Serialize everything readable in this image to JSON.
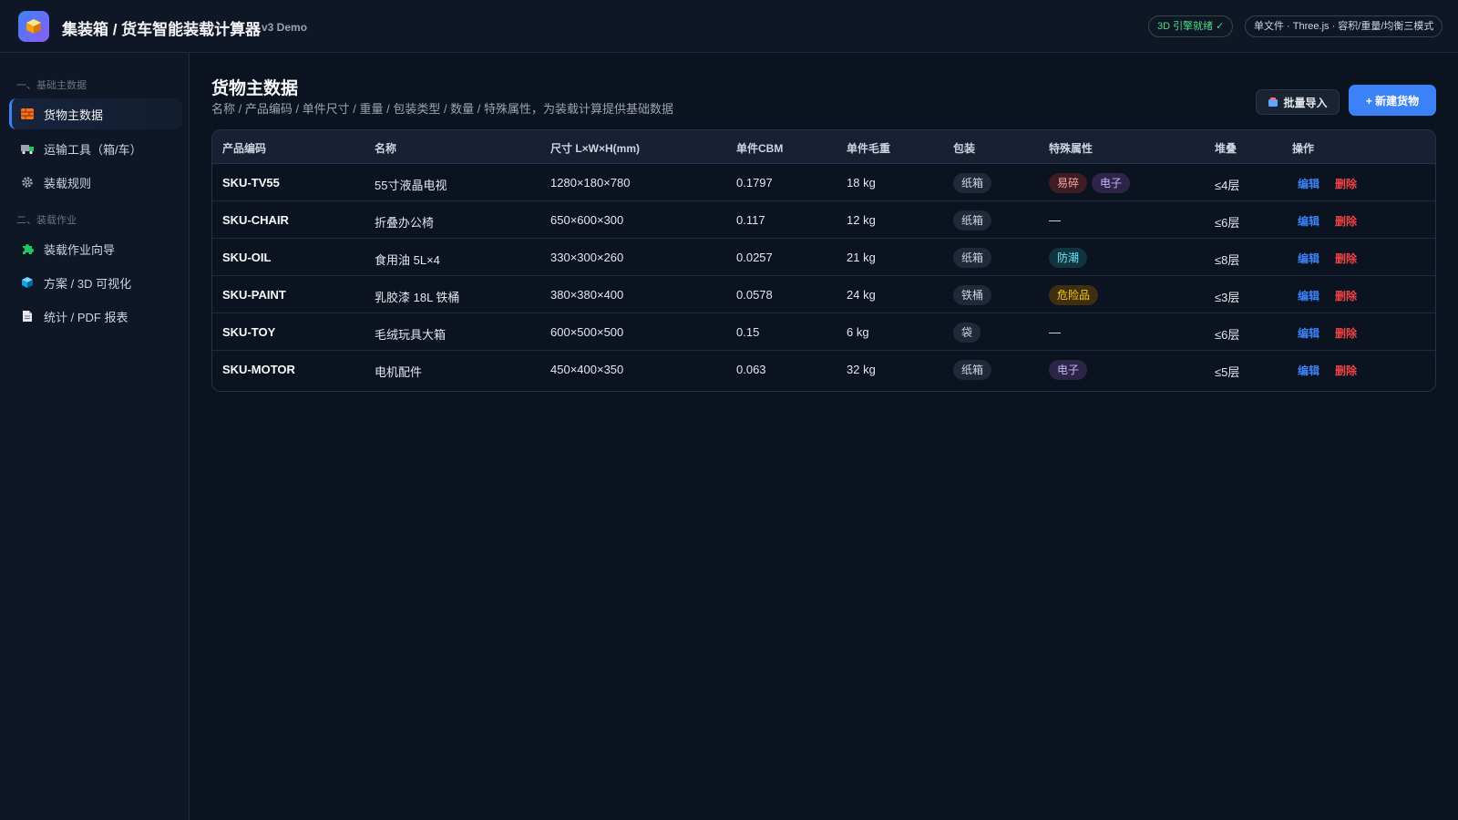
{
  "header": {
    "app_title": "集装箱 / 货车智能装载计算器",
    "version": "v3 Demo",
    "engine_status": "3D 引擎就绪 ✓",
    "mode_info": "单文件 · Three.js · 容积/重量/均衡三模式"
  },
  "sidebar": {
    "section1": "一、基础主数据",
    "section2": "二、装载作业",
    "items": [
      {
        "label": "货物主数据",
        "icon": "bricks-icon"
      },
      {
        "label": "运输工具（箱/车）",
        "icon": "truck-icon"
      },
      {
        "label": "装载规则",
        "icon": "gear-icon"
      },
      {
        "label": "装载作业向导",
        "icon": "puzzle-icon"
      },
      {
        "label": "方案 / 3D 可视化",
        "icon": "cube-icon"
      },
      {
        "label": "统计 / PDF 报表",
        "icon": "document-icon"
      }
    ]
  },
  "main": {
    "title": "货物主数据",
    "subtitle": "名称 / 产品编码 / 单件尺寸 / 重量 / 包装类型 / 数量 / 特殊属性，为装载计算提供基础数据",
    "import_label": "批量导入",
    "new_label": "+ 新建货物"
  },
  "table": {
    "columns": [
      "产品编码",
      "名称",
      "尺寸 L×W×H(mm)",
      "单件CBM",
      "单件毛重",
      "包装",
      "特殊属性",
      "堆叠",
      "操作"
    ],
    "edit_label": "编辑",
    "delete_label": "删除",
    "rows": [
      {
        "code": "SKU-TV55",
        "name": "55寸液晶电视",
        "dims": "1280×180×780",
        "cbm": "0.1797",
        "weight": "18 kg",
        "pack": "纸箱",
        "attrs": [
          "易碎",
          "电子"
        ],
        "stack": "≤4层"
      },
      {
        "code": "SKU-CHAIR",
        "name": "折叠办公椅",
        "dims": "650×600×300",
        "cbm": "0.117",
        "weight": "12 kg",
        "pack": "纸箱",
        "attrs": [],
        "stack": "≤6层",
        "empty_attr": "—"
      },
      {
        "code": "SKU-OIL",
        "name": "食用油 5L×4",
        "dims": "330×300×260",
        "cbm": "0.0257",
        "weight": "21 kg",
        "pack": "纸箱",
        "attrs": [
          "防潮"
        ],
        "stack": "≤8层"
      },
      {
        "code": "SKU-PAINT",
        "name": "乳胶漆 18L 铁桶",
        "dims": "380×380×400",
        "cbm": "0.0578",
        "weight": "24 kg",
        "pack": "铁桶",
        "attrs": [
          "危险品"
        ],
        "stack": "≤3层"
      },
      {
        "code": "SKU-TOY",
        "name": "毛绒玩具大箱",
        "dims": "600×500×500",
        "cbm": "0.15",
        "weight": "6 kg",
        "pack": "袋",
        "attrs": [],
        "stack": "≤6层",
        "empty_attr": "—"
      },
      {
        "code": "SKU-MOTOR",
        "name": "电机配件",
        "dims": "450×400×350",
        "cbm": "0.063",
        "weight": "32 kg",
        "pack": "纸箱",
        "attrs": [
          "电子"
        ],
        "stack": "≤5层"
      }
    ]
  },
  "colors": {
    "accent": "#3b82f6",
    "danger": "#ef4444",
    "background": "#0b1220",
    "ready": "#4ade80"
  }
}
